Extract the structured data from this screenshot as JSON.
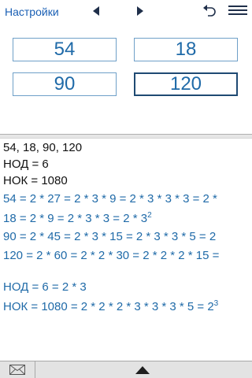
{
  "toolbar": {
    "settings_label": "Настройки",
    "icons": [
      "prev-arrow-icon",
      "next-arrow-icon",
      "undo-icon",
      "menu-icon"
    ]
  },
  "inputs": {
    "values": [
      "54",
      "18",
      "90",
      "120"
    ],
    "active_index": 3
  },
  "results": {
    "lines": [
      "54, 18, 90, 120",
      "НОД = 6",
      "НОК = 1080",
      "54 = 2 * 27 = 2 * 3 * 9 = 2 * 3 * 3 * 3 = 2 *",
      "18 = 2 * 9 = 2 * 3 * 3 = 2 * 3",
      "90 = 2 * 45 = 2 * 3 * 15 = 2 * 3 * 3 * 5 = 2",
      "120 = 2 * 60 = 2 * 2 * 30 = 2 * 2 * 2 * 15 =",
      "НОД = 6 = 2 * 3",
      "НОК = 1080 = 2 * 2 * 2 * 3 * 3 * 3 * 5 = 2"
    ],
    "sup_18": "2",
    "sup_nok": "3"
  },
  "colors": {
    "accent": "#1f6aa8",
    "link": "#1a5fb4",
    "text": "#111111",
    "bar": "#e3e3e3"
  },
  "bottom": {
    "icons": [
      "mail-icon",
      "expand-up-icon"
    ]
  }
}
